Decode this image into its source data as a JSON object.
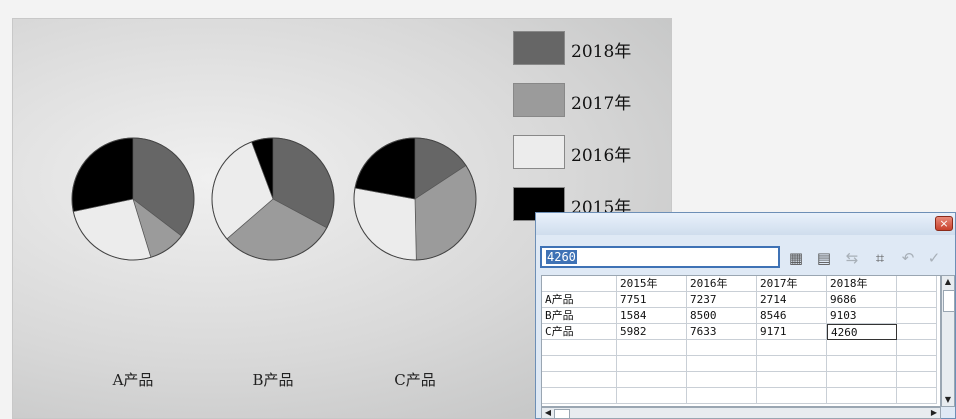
{
  "chart_data": {
    "type": "pie",
    "categories": [
      "A产品",
      "B产品",
      "C产品"
    ],
    "series": [
      {
        "name": "2015年",
        "values": [
          7751,
          1584,
          5982
        ],
        "color": "#000000"
      },
      {
        "name": "2016年",
        "values": [
          7237,
          8500,
          7633
        ],
        "color": "#ececec"
      },
      {
        "name": "2017年",
        "values": [
          2714,
          8546,
          9171
        ],
        "color": "#9b9b9b"
      },
      {
        "name": "2018年",
        "values": [
          9686,
          9103,
          4260
        ],
        "color": "#666666"
      }
    ],
    "legend_order": [
      "2018年",
      "2017年",
      "2016年",
      "2015年"
    ],
    "legend": "right"
  },
  "sheet": {
    "edit_value": "4260",
    "headers": [
      "",
      "2015年",
      "2016年",
      "2017年",
      "2018年",
      ""
    ],
    "rows": [
      [
        "A产品",
        "7751",
        "7237",
        "2714",
        "9686",
        ""
      ],
      [
        "B产品",
        "1584",
        "8500",
        "8546",
        "9103",
        ""
      ],
      [
        "C产品",
        "5982",
        "7633",
        "9171",
        "4260",
        ""
      ],
      [
        "",
        "",
        "",
        "",
        "",
        ""
      ],
      [
        "",
        "",
        "",
        "",
        "",
        ""
      ],
      [
        "",
        "",
        "",
        "",
        "",
        ""
      ],
      [
        "",
        "",
        "",
        "",
        "",
        ""
      ]
    ],
    "selected": [
      2,
      4
    ],
    "close_glyph": "×",
    "toolbar_icons": [
      {
        "name": "import-icon",
        "glyph": "▦",
        "enabled": true
      },
      {
        "name": "edit-data-icon",
        "glyph": "▤",
        "enabled": true
      },
      {
        "name": "switch-row-col-icon",
        "glyph": "⇆",
        "enabled": false
      },
      {
        "name": "column-width-icon",
        "glyph": "⌗",
        "enabled": true
      },
      {
        "name": "undo-icon",
        "glyph": "↶",
        "enabled": false
      },
      {
        "name": "apply-icon",
        "glyph": "✓",
        "enabled": false
      }
    ]
  }
}
